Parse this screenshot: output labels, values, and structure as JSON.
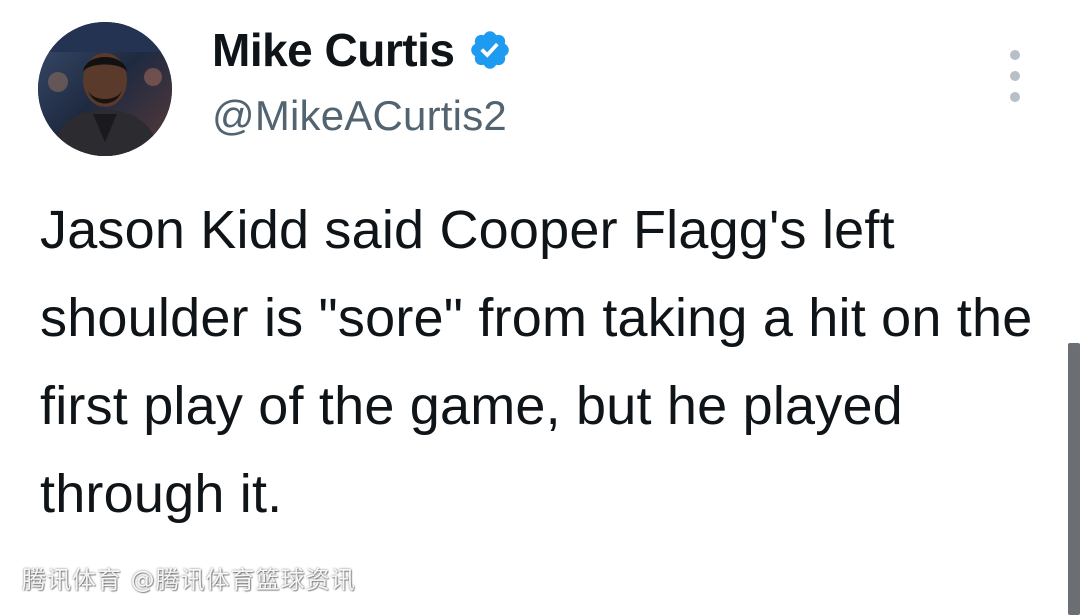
{
  "author": {
    "display_name": "Mike Curtis",
    "handle": "@MikeACurtis2",
    "verified": true,
    "avatar_icon": "profile-photo",
    "verified_color": "#1d9bf0"
  },
  "tweet": {
    "text": "Jason Kidd said Cooper Flagg's left shoulder is \"sore\" from taking a hit on the first play of the game, but he played through it."
  },
  "menu": {
    "icon": "more-vertical-icon"
  },
  "watermark": {
    "text": "腾讯体育 @腾讯体育篮球资讯"
  },
  "colors": {
    "text_primary": "#0f1419",
    "text_secondary": "#536471",
    "background": "#ffffff"
  }
}
